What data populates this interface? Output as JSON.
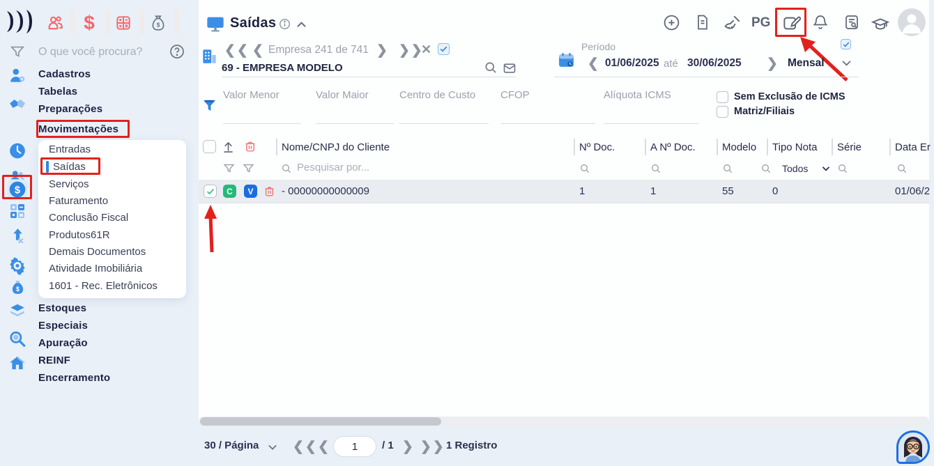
{
  "sidebar": {
    "search_placeholder": "O que você procura?",
    "menu_top": [
      "Cadastros",
      "Tabelas",
      "Preparações"
    ],
    "movimentacoes_label": "Movimentações",
    "submenu": [
      "Entradas",
      "Saídas",
      "Serviços",
      "Faturamento",
      "Conclusão Fiscal",
      "Produtos61R",
      "Demais Documentos",
      "Atividade Imobiliária",
      "1601 - Rec. Eletrônicos"
    ],
    "menu_bottom": [
      "Estoques",
      "Especiais",
      "Apuração",
      "REINF",
      "Encerramento"
    ]
  },
  "header": {
    "title": "Saídas",
    "pg": "PG"
  },
  "company": {
    "nav": "Empresa 241 de 741",
    "name": "69 - EMPRESA MODELO"
  },
  "period": {
    "label": "Período",
    "start": "01/06/2025",
    "until": "até",
    "end": "30/06/2025",
    "mode": "Mensal"
  },
  "filters": {
    "valor_menor": "Valor Menor",
    "valor_maior": "Valor Maior",
    "centro_custo": "Centro de Custo",
    "cfop": "CFOP",
    "aliquota": "Alíquota ICMS",
    "cb_sem_exclusao": "Sem Exclusão de ICMS",
    "cb_matriz": "Matriz/Filiais"
  },
  "table": {
    "col_cliente": "Nome/CNPJ do Cliente",
    "col_ndoc": "Nº Doc.",
    "col_andoc": "A Nº Doc.",
    "col_modelo": "Modelo",
    "col_tiponota": "Tipo Nota",
    "col_serie": "Série",
    "col_data": "Data Er",
    "search_placeholder": "Pesquisar por...",
    "tiponota_filter": "Todos",
    "row": {
      "badge_c": "C",
      "badge_v": "V",
      "cliente": "- 00000000000009",
      "ndoc": "1",
      "andoc": "1",
      "modelo": "55",
      "tiponota": "0",
      "data": "01/06/2"
    }
  },
  "pagination": {
    "per_page": "30 / Página",
    "page_value": "1",
    "page_total": "/ 1",
    "records": "1 Registro"
  },
  "colors": {
    "accent_blue": "#3a8ee6",
    "coral": "#f4686c",
    "annotation_red": "#e2211c",
    "badge_green": "#25b97a",
    "badge_blue": "#1b6ce0",
    "dark_navy": "#1e2342"
  }
}
